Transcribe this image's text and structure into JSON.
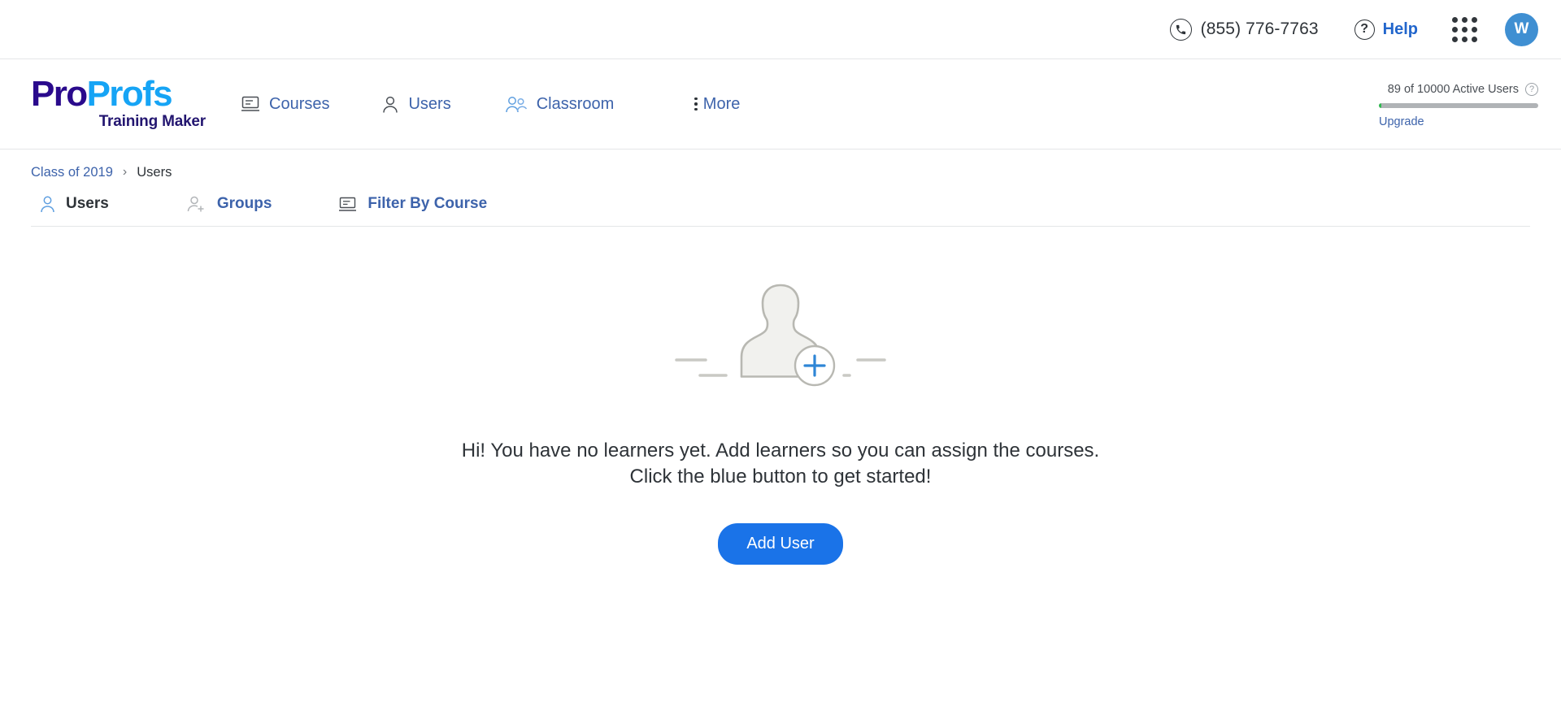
{
  "utility_bar": {
    "phone_icon": "phone-circle-icon",
    "phone_number": "(855) 776-7763",
    "help_icon": "question-circle-icon",
    "help_label": "Help",
    "apps_icon": "apps-grid-icon",
    "avatar_initial": "W",
    "avatar_color": "#3f8fd2"
  },
  "logo": {
    "part1": "Pro",
    "part2": "Profs",
    "tagline": "Training Maker",
    "color1": "#2a0a8c",
    "color2": "#16a4f5",
    "tagline_color": "#231670"
  },
  "nav": {
    "items": [
      {
        "label": "Courses",
        "icon": "courses-icon"
      },
      {
        "label": "Users",
        "icon": "user-icon"
      },
      {
        "label": "Classroom",
        "icon": "classroom-icon"
      },
      {
        "label": "More",
        "icon": "kebab-menu-icon"
      }
    ]
  },
  "usage": {
    "text": "89 of 10000 Active Users",
    "help_icon": "question-mark-icon",
    "used": 89,
    "total": 10000,
    "percent": 0.89,
    "fill_color": "#2db94d",
    "track_color": "#b0b3b6",
    "upgrade_label": "Upgrade"
  },
  "breadcrumb": {
    "parent": "Class of 2019",
    "separator": "›",
    "current": "Users"
  },
  "tabs": [
    {
      "label": "Users",
      "icon": "user-outline-icon",
      "active": true
    },
    {
      "label": "Groups",
      "icon": "group-add-icon",
      "active": false
    },
    {
      "label": "Filter By Course",
      "icon": "course-filter-icon",
      "active": false
    }
  ],
  "empty_state": {
    "illustration": "add-learner-illustration",
    "message_line1": "Hi! You have no learners yet. Add learners so you can assign the courses.",
    "message_line2": "Click the blue button to get started!",
    "button_label": "Add User",
    "button_color": "#1a73e8"
  }
}
